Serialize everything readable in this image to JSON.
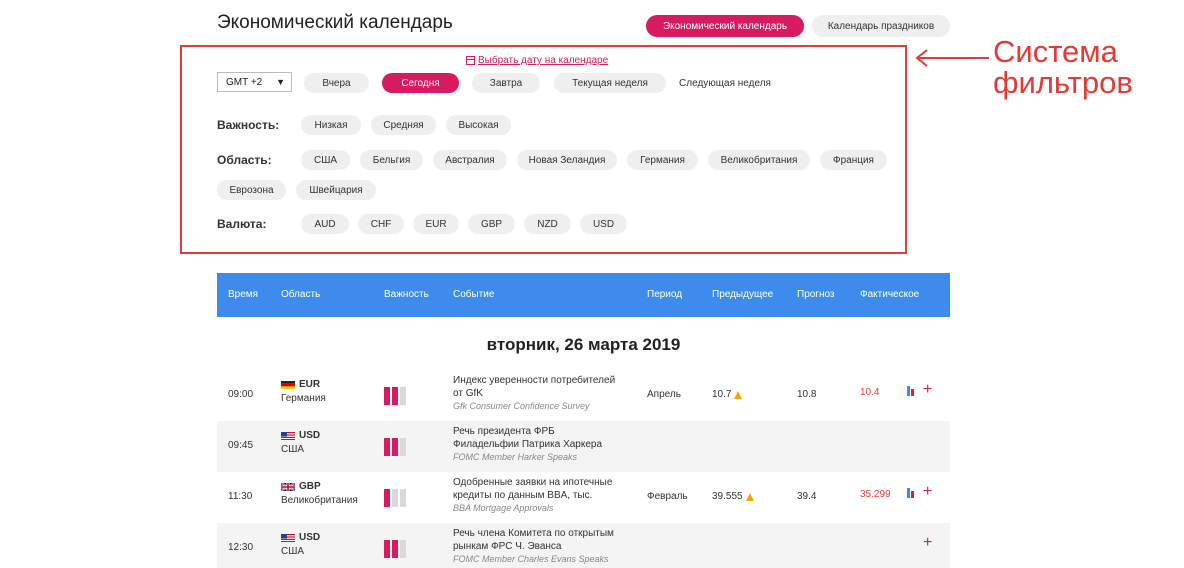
{
  "header": {
    "title": "Экономический календарь",
    "tabs": [
      "Экономический календарь",
      "Календарь праздников"
    ]
  },
  "filters": {
    "date_link": "Выбрать дату на календаре",
    "timezone": "GMT +2",
    "days": [
      "Вчера",
      "Сегодня",
      "Завтра",
      "Текущая неделя",
      "Следующая неделя"
    ],
    "active_day": "Сегодня",
    "importance_label": "Важность:",
    "importance": [
      "Низкая",
      "Средняя",
      "Высокая"
    ],
    "region_label": "Область:",
    "regions": [
      "США",
      "Бельгия",
      "Австралия",
      "Новая Зеландия",
      "Германия",
      "Великобритания",
      "Франция",
      "Еврозона",
      "Швейцария"
    ],
    "currency_label": "Валюта:",
    "currencies": [
      "AUD",
      "CHF",
      "EUR",
      "GBP",
      "NZD",
      "USD"
    ]
  },
  "annotation": {
    "line1": "Система",
    "line2": "фильтров",
    "color": "#e53935"
  },
  "table": {
    "headers": [
      "Время",
      "Область",
      "Важность",
      "Событие",
      "Период",
      "Предыдущее",
      "Прогноз",
      "Фактическое"
    ],
    "date": "вторник, 26 марта 2019",
    "rows": [
      {
        "time": "09:00",
        "currency": "EUR",
        "country": "Германия",
        "importance": 2,
        "event_ru_1": "Индекс уверенности потребителей",
        "event_ru_2": "от GfK",
        "event_en": "Gfk Consumer Confidence Survey",
        "period": "Апрель",
        "previous": "10.7",
        "forecast": "10.8",
        "actual": "10.4"
      },
      {
        "time": "09:45",
        "currency": "USD",
        "country": "США",
        "importance": 2,
        "event_ru_1": "Речь президента ФРБ",
        "event_ru_2": "Филадельфии Патрика Харкера",
        "event_en": "FOMC Member Harker Speaks",
        "period": "",
        "previous": "",
        "forecast": "",
        "actual": ""
      },
      {
        "time": "11:30",
        "currency": "GBP",
        "country": "Великобритания",
        "importance": 1,
        "event_ru_1": "Одобренные заявки на ипотечные",
        "event_ru_2": "кредиты по данным BBA, тыс.",
        "event_en": "BBA Mortgage Approvals",
        "period": "Февраль",
        "previous": "39.555",
        "forecast": "39.4",
        "actual": "35.299"
      },
      {
        "time": "12:30",
        "currency": "USD",
        "country": "США",
        "importance": 2,
        "event_ru_1": "Речь члена Комитета по открытым",
        "event_ru_2": "рынкам ФРС Ч. Эванса",
        "event_en": "FOMC Member Charles Evans Speaks",
        "period": "",
        "previous": "",
        "forecast": "",
        "actual": ""
      }
    ]
  },
  "colors": {
    "accent": "#d81b60",
    "header_blue": "#3d8ced",
    "warning": "#f2a900"
  }
}
